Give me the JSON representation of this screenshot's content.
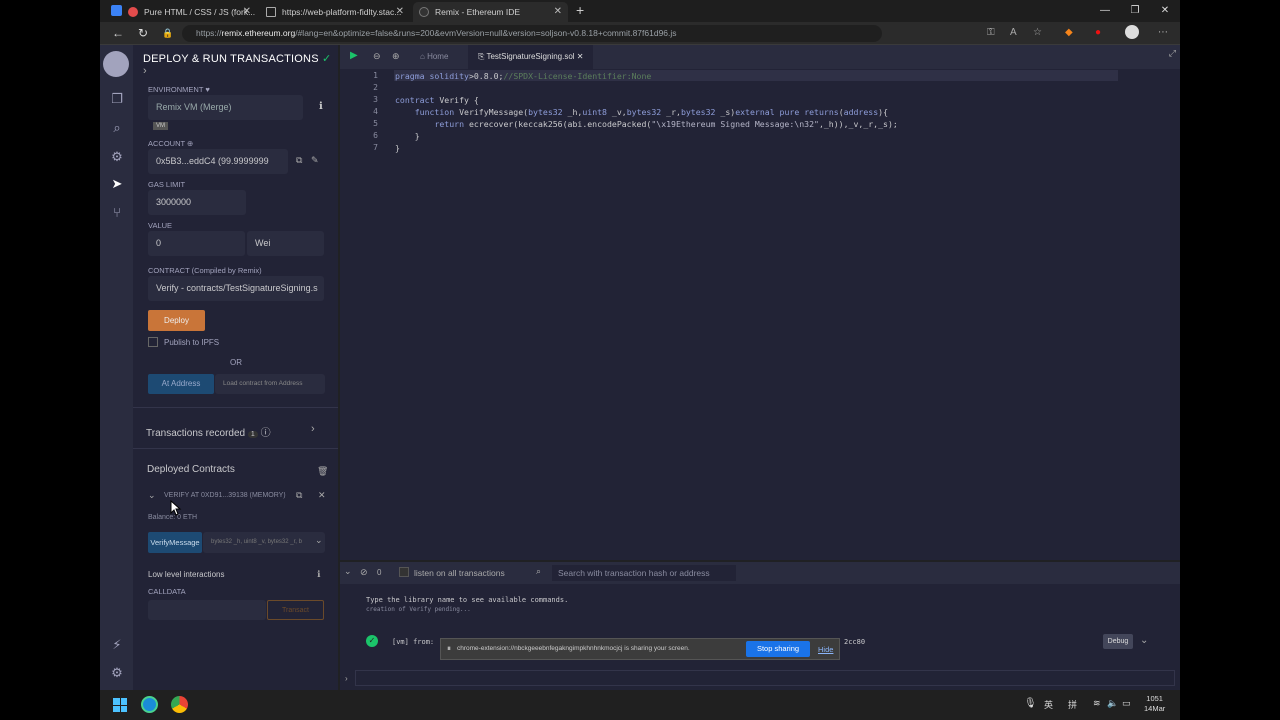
{
  "browser": {
    "tabs": [
      {
        "title": "Pure HTML / CSS / JS (fork..."
      },
      {
        "title": "https://web-platform-fidlty.stac..."
      },
      {
        "title": "Remix - Ethereum IDE"
      }
    ],
    "url_prefix": "https://",
    "url_host": "remix.ethereum.org",
    "url_rest": "/#lang=en&optimize=false&runs=200&evmVersion=null&version=soljson-v0.8.18+commit.87f61d96.js"
  },
  "side": {
    "title": "DEPLOY & RUN TRANSACTIONS",
    "environment_label": "ENVIRONMENT",
    "environment_value": "Remix VM (Merge)",
    "vm_badge": "VM",
    "account_label": "ACCOUNT",
    "account_value": "0x5B3...eddC4 (99.9999999",
    "gas_limit_label": "GAS LIMIT",
    "gas_limit_value": "3000000",
    "value_label": "VALUE",
    "value_value": "0",
    "value_unit": "Wei",
    "contract_label": "CONTRACT",
    "contract_note": "(Compiled by Remix)",
    "contract_value": "Verify - contracts/TestSignatureSigning.s",
    "deploy_label": "Deploy",
    "publish_label": "Publish to IPFS",
    "or_label": "OR",
    "at_address_label": "At Address",
    "load_contract_placeholder": "Load contract from Address",
    "transactions_recorded": "Transactions recorded",
    "tx_count": "1",
    "deployed_contracts": "Deployed Contracts",
    "instance_label": "VERIFY AT 0XD91...39138 (MEMORY)",
    "balance": "Balance: 0 ETH",
    "fn_button": "VerifyMessage",
    "fn_params": "bytes32 _h, uint8 _v, bytes32 _r, b",
    "low_level": "Low level interactions",
    "calldata_label": "CALLDATA",
    "transact_label": "Transact"
  },
  "editor": {
    "tabs": [
      {
        "label": "Home"
      },
      {
        "label": "TestSignatureSigning.sol"
      }
    ],
    "lines": [
      "1",
      "2",
      "3",
      "4",
      "5",
      "6",
      "7"
    ]
  },
  "terminal": {
    "count": "0",
    "listen_label": "listen on all transactions",
    "search_placeholder": "Search with transaction hash or address",
    "line1": "Type the library name to see available commands.",
    "line2": "creation of Verify pending...",
    "vm_tag": "[vm]",
    "from_label": "from:",
    "hash_tail": "2cc80",
    "debug_label": "Debug"
  },
  "share_bar": {
    "text": "chrome-extension://nbckgeeebnfegakngimpkhnhnkmocjcj is sharing your screen.",
    "stop_label": "Stop sharing",
    "hide_label": "Hide"
  },
  "taskbar": {
    "lang1": "英",
    "lang2": "拼",
    "time": "1051",
    "date": "14Mar"
  }
}
